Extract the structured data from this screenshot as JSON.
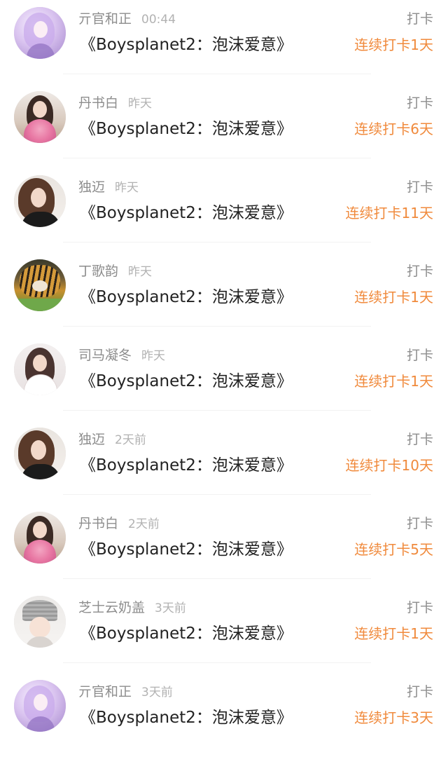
{
  "colors": {
    "name": "#8d8d8d",
    "time": "#b2b2b2",
    "title": "#222222",
    "streak": "#f08a3c",
    "divider": "#f2f2f2",
    "background": "#ffffff"
  },
  "feed": {
    "items": [
      {
        "name": "亓官和正",
        "time": "00:44",
        "title": "《Boysplanet2：泡沫爱意》",
        "action": "打卡",
        "streak": "连续打卡1天",
        "avatar_icon": "anime-girl-avatar-icon"
      },
      {
        "name": "丹书白",
        "time": "昨天",
        "title": "《Boysplanet2：泡沫爱意》",
        "action": "打卡",
        "streak": "连续打卡6天",
        "avatar_icon": "woman-with-flowers-avatar-icon"
      },
      {
        "name": "独迈",
        "time": "昨天",
        "title": "《Boysplanet2：泡沫爱意》",
        "action": "打卡",
        "streak": "连续打卡11天",
        "avatar_icon": "woman-portrait-avatar-icon"
      },
      {
        "name": "丁歌韵",
        "time": "昨天",
        "title": "《Boysplanet2：泡沫爱意》",
        "action": "打卡",
        "streak": "连续打卡1天",
        "avatar_icon": "tiger-avatar-icon"
      },
      {
        "name": "司马凝冬",
        "time": "昨天",
        "title": "《Boysplanet2：泡沫爱意》",
        "action": "打卡",
        "streak": "连续打卡1天",
        "avatar_icon": "woman-white-dress-avatar-icon"
      },
      {
        "name": "独迈",
        "time": "2天前",
        "title": "《Boysplanet2：泡沫爱意》",
        "action": "打卡",
        "streak": "连续打卡10天",
        "avatar_icon": "woman-portrait-avatar-icon"
      },
      {
        "name": "丹书白",
        "time": "2天前",
        "title": "《Boysplanet2：泡沫爱意》",
        "action": "打卡",
        "streak": "连续打卡5天",
        "avatar_icon": "woman-with-flowers-avatar-icon"
      },
      {
        "name": "芝士云奶盖",
        "time": "3天前",
        "title": "《Boysplanet2：泡沫爱意》",
        "action": "打卡",
        "streak": "连续打卡1天",
        "avatar_icon": "person-beanie-avatar-icon"
      },
      {
        "name": "亓官和正",
        "time": "3天前",
        "title": "《Boysplanet2：泡沫爱意》",
        "action": "打卡",
        "streak": "连续打卡3天",
        "avatar_icon": "anime-girl-avatar-icon"
      }
    ]
  }
}
